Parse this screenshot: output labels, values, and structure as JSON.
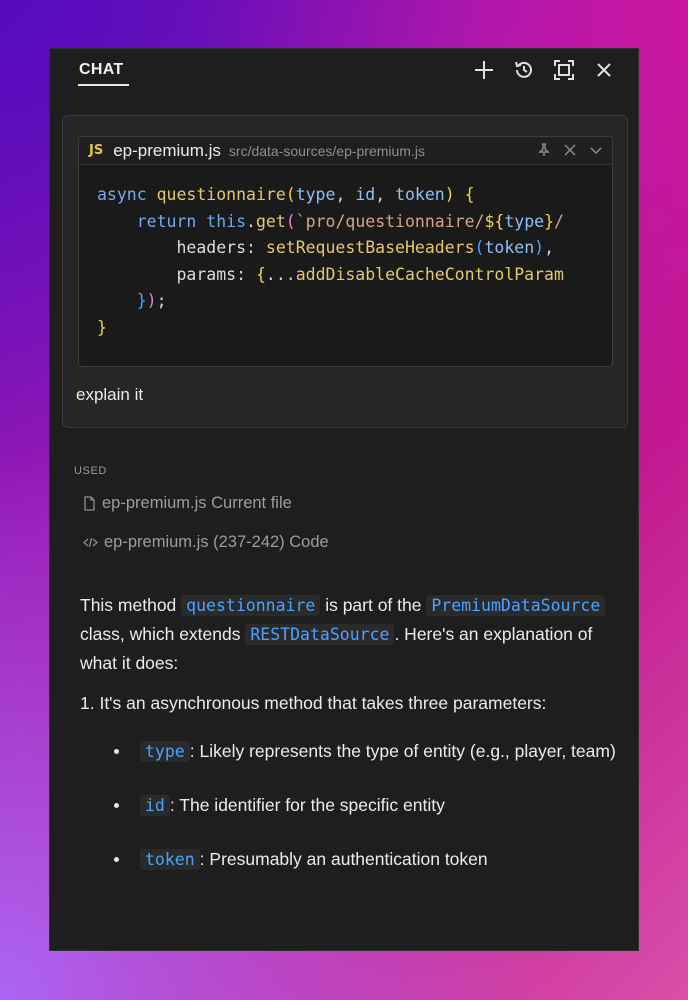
{
  "header": {
    "tab_label": "CHAT",
    "icons": [
      "plus-icon",
      "history-icon",
      "maximize-icon",
      "close-icon"
    ]
  },
  "query": {
    "file_badge": "JS",
    "file_name": "ep-premium.js",
    "file_path": "src/data-sources/ep-premium.js",
    "code_lines": [
      "async questionnaire(type, id, token) {",
      "    return this.get(`pro/questionnaire/${type}/",
      "        headers: setRequestBaseHeaders(token),",
      "        params: {...addDisableCacheControlParam",
      "    });",
      "}"
    ],
    "text": "explain it"
  },
  "used": {
    "label": "USED",
    "items": [
      {
        "file": "ep-premium.js",
        "detail": "Current file"
      },
      {
        "file": "ep-premium.js",
        "detail": "(237-242) Code"
      }
    ]
  },
  "answer": {
    "p1_a": "This method",
    "p1_code1": "questionnaire",
    "p1_b": "is part of the",
    "p1_code2": "PremiumDataSource",
    "p1_c": "class, which extends",
    "p1_code3": "RESTDataSource",
    "p1_d": ". Here's an explanation of what it does:",
    "list_intro": "1. It's an asynchronous method that takes three parameters:",
    "params": [
      {
        "name": "type",
        "desc": ": Likely represents the type of entity (e.g., player, team)"
      },
      {
        "name": "id",
        "desc": ": The identifier for the specific entity"
      },
      {
        "name": "token",
        "desc": ": Presumably an authentication token"
      }
    ]
  },
  "colors": {
    "panel_bg": "#1e1e1f",
    "accent_code": "#4aa3ff",
    "js_badge": "#e8c547"
  }
}
